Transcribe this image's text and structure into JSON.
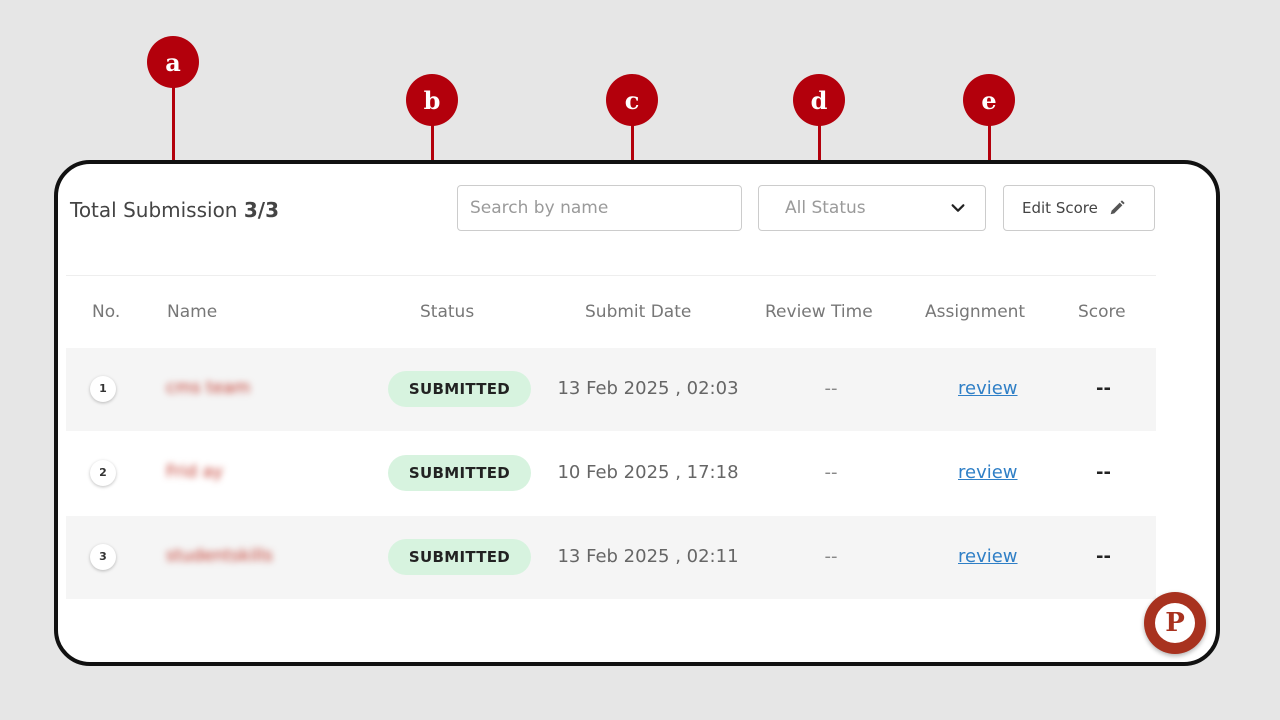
{
  "header": {
    "total_label": "Total Submission",
    "total_count": "3/3",
    "search_placeholder": "Search by name",
    "status_filter": "All Status",
    "edit_score_label": "Edit Score"
  },
  "table": {
    "columns": [
      "No.",
      "Name",
      "Status",
      "Submit Date",
      "Review Time",
      "Assignment",
      "Score"
    ],
    "rows": [
      {
        "no": "1",
        "name": "cms team",
        "status": "SUBMITTED",
        "submit_date": "13 Feb 2025 , 02:03",
        "review_time": "--",
        "assignment": "review",
        "score": "--"
      },
      {
        "no": "2",
        "name": "Frid ay",
        "status": "SUBMITTED",
        "submit_date": "10 Feb 2025 , 17:18",
        "review_time": "--",
        "assignment": "review",
        "score": "--"
      },
      {
        "no": "3",
        "name": "studentskills",
        "status": "SUBMITTED",
        "submit_date": "13 Feb 2025 , 02:11",
        "review_time": "--",
        "assignment": "review",
        "score": "--"
      }
    ]
  },
  "callouts": [
    "a",
    "b",
    "c",
    "d",
    "e"
  ],
  "logo_letter": "P",
  "colors": {
    "callout": "#b3000c",
    "badge_bg": "#d7f3df",
    "link": "#2f7fc6"
  }
}
